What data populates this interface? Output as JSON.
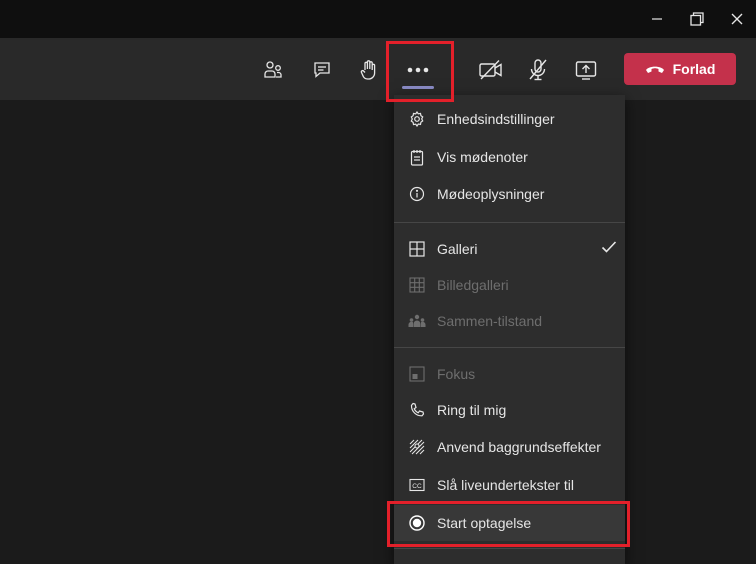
{
  "window": {
    "minimize_icon": "minimize-icon",
    "maximize_icon": "restore-icon",
    "close_icon": "close-icon"
  },
  "toolbar": {
    "buttons": [
      {
        "name": "participants-button",
        "icon": "people-icon"
      },
      {
        "name": "chat-button",
        "icon": "chat-icon"
      },
      {
        "name": "raise-hand-button",
        "icon": "hand-icon"
      },
      {
        "name": "more-actions-button",
        "icon": "more-icon"
      },
      {
        "name": "camera-button",
        "icon": "camera-off-icon"
      },
      {
        "name": "mic-button",
        "icon": "mic-off-icon"
      },
      {
        "name": "share-button",
        "icon": "share-screen-icon"
      }
    ],
    "leave_label": "Forlad",
    "leave_color": "#c4314b",
    "more_underline_color": "#8b8cc7"
  },
  "menu": {
    "items": [
      {
        "label": "Enhedsindstillinger",
        "icon": "gear-icon",
        "enabled": true
      },
      {
        "label": "Vis mødenoter",
        "icon": "notes-icon",
        "enabled": true
      },
      {
        "label": "Mødeoplysninger",
        "icon": "info-icon",
        "enabled": true
      },
      {
        "label": "Galleri",
        "icon": "gallery-icon",
        "enabled": true,
        "checked": true
      },
      {
        "label": "Billedgalleri",
        "icon": "large-gallery-icon",
        "enabled": false
      },
      {
        "label": "Sammen-tilstand",
        "icon": "together-mode-icon",
        "enabled": false
      },
      {
        "label": "Fokus",
        "icon": "focus-icon",
        "enabled": false
      },
      {
        "label": "Ring til mig",
        "icon": "phone-icon",
        "enabled": true
      },
      {
        "label": "Anvend baggrundseffekter",
        "icon": "background-effects-icon",
        "enabled": true
      },
      {
        "label": "Slå liveundertekster til",
        "icon": "captions-icon",
        "enabled": true
      },
      {
        "label": "Start optagelse",
        "icon": "record-icon",
        "enabled": true,
        "highlighted": true
      }
    ]
  },
  "highlight_color": "#e3202a"
}
